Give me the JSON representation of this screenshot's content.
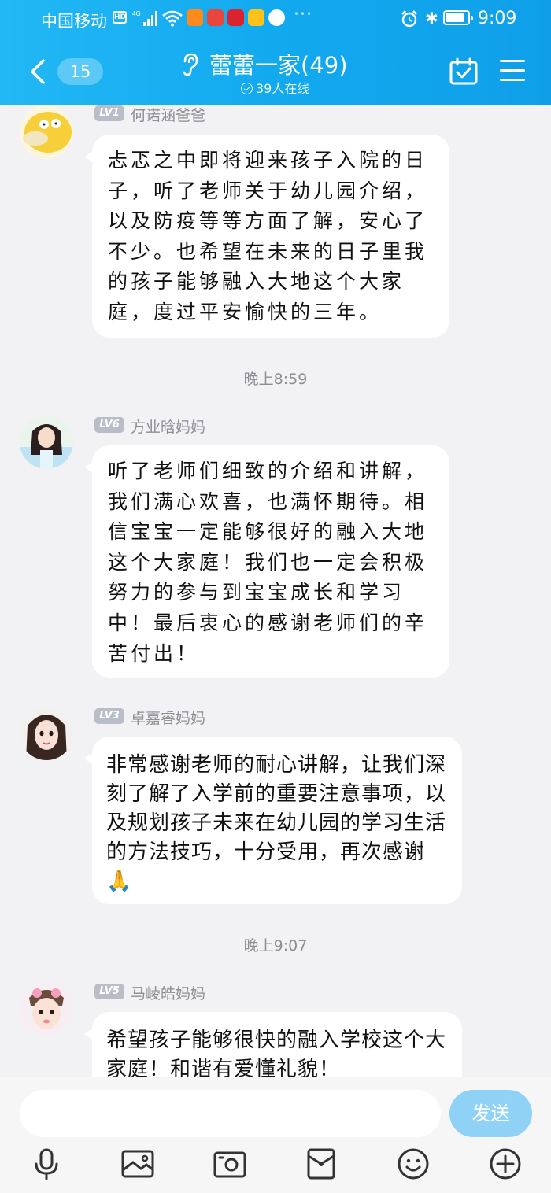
{
  "status_bar": {
    "carrier": "中国移动",
    "network": "4G",
    "time": "9:09"
  },
  "header": {
    "unread": "15",
    "title": "蕾蕾一家(49)",
    "online": "39人在线"
  },
  "messages": [
    {
      "level": "LV1",
      "sender": "何诺涵爸爸",
      "text": "忐忑之中即将迎来孩子入院的日子，听了老师关于幼儿园介绍，以及防疫等等方面了解，安心了不少。也希望在未来的日子里我的孩子能够融入大地这个大家庭，度过平安愉快的三年。"
    },
    {
      "time": "晚上8:59"
    },
    {
      "level": "LV6",
      "sender": "方业晗妈妈",
      "text": "听了老师们细致的介绍和讲解，我们满心欢喜，也满怀期待。相信宝宝一定能够很好的融入大地这个大家庭！我们也一定会积极努力的参与到宝宝成长和学习中！最后衷心的感谢老师们的辛苦付出！"
    },
    {
      "level": "LV3",
      "sender": "卓嘉睿妈妈",
      "text": "非常感谢老师的耐心讲解，让我们深刻了解了入学前的重要注意事项，以及规划孩子未来在幼儿园的学习生活的方法技巧，十分受用，再次感谢🙏"
    },
    {
      "time": "晚上9:07"
    },
    {
      "level": "LV5",
      "sender": "马崚皓妈妈",
      "text": "希望孩子能够很快的融入学校这个大家庭！和谐有爱懂礼貌！"
    }
  ],
  "input": {
    "send_label": "发送"
  },
  "toolbar": [
    "mic-icon",
    "image-icon",
    "camera-icon",
    "red-packet-icon",
    "emoji-icon",
    "plus-icon"
  ]
}
